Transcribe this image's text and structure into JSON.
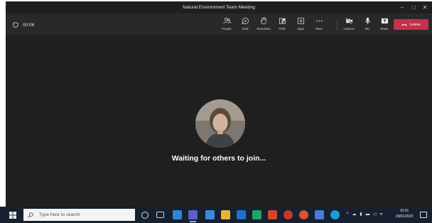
{
  "window": {
    "title": "Natural Environment Team Meeting",
    "controls": [
      "–",
      "□",
      "✕"
    ]
  },
  "toolbar": {
    "timer": "00:06",
    "buttons": [
      {
        "label": "People",
        "icon": "people-icon"
      },
      {
        "label": "Chat",
        "icon": "chat-icon"
      },
      {
        "label": "Reactions",
        "icon": "reactions-icon"
      },
      {
        "label": "Polls",
        "icon": "polls-icon"
      },
      {
        "label": "Apps",
        "icon": "apps-icon"
      },
      {
        "label": "More",
        "icon": "more-icon"
      },
      {
        "label": "Camera",
        "icon": "camera-off-icon"
      },
      {
        "label": "Mic",
        "icon": "mic-icon"
      },
      {
        "label": "Share",
        "icon": "share-icon"
      }
    ],
    "leave_label": "Leave",
    "leave_color": "#c4314b"
  },
  "stage": {
    "message": "Waiting for others to join..."
  },
  "taskbar": {
    "search_placeholder": "Type here to search",
    "clock_time": "10:41",
    "clock_date": "19/01/2023",
    "tray": [
      "^",
      "☁",
      "▮",
      "▬",
      "◁",
      "ᯤ"
    ],
    "accent": "#6fb3ff"
  }
}
